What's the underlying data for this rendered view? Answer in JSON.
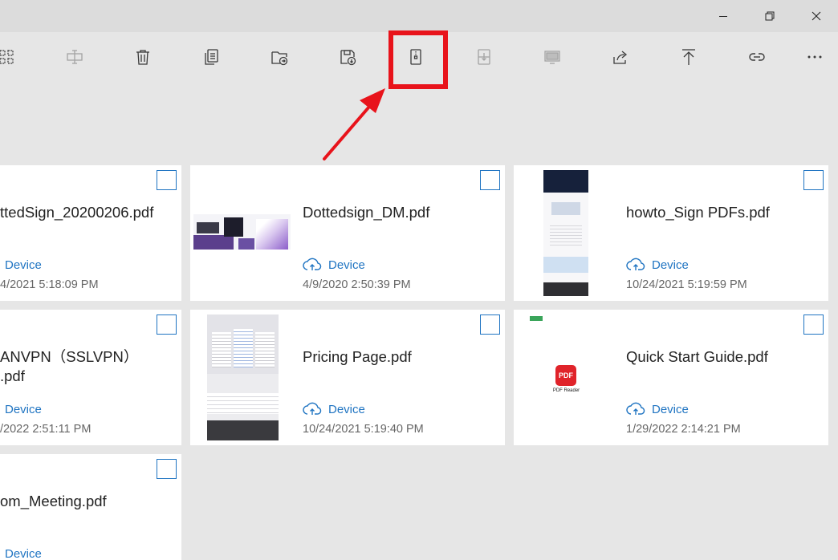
{
  "window": {
    "minimize_icon": "minimize-icon",
    "maximize_icon": "restore-icon",
    "close_icon": "close-icon"
  },
  "toolbar": {
    "buttons": [
      {
        "id": "select",
        "icon": "grid-select-icon",
        "disabled": false
      },
      {
        "id": "rename",
        "icon": "rename-icon",
        "disabled": true
      },
      {
        "id": "delete",
        "icon": "trash-icon",
        "disabled": false
      },
      {
        "id": "copy",
        "icon": "copy-icon",
        "disabled": false
      },
      {
        "id": "move",
        "icon": "move-to-folder-icon",
        "disabled": false
      },
      {
        "id": "save",
        "icon": "save-icon",
        "disabled": false
      },
      {
        "id": "compress",
        "icon": "zip-file-icon",
        "disabled": false,
        "highlighted": true
      },
      {
        "id": "extract",
        "icon": "extract-icon",
        "disabled": true
      },
      {
        "id": "present",
        "icon": "monitor-icon",
        "disabled": true
      },
      {
        "id": "share",
        "icon": "share-icon",
        "disabled": false
      },
      {
        "id": "upload",
        "icon": "upload-icon",
        "disabled": false
      },
      {
        "id": "link",
        "icon": "link-icon",
        "disabled": false
      },
      {
        "id": "more",
        "icon": "more-icon",
        "label": "···",
        "disabled": false
      }
    ]
  },
  "annotation": {
    "color": "#e8131b"
  },
  "files": [
    {
      "name": "ttedSign_20200206.pdf",
      "location": "Device",
      "date": "4/2021 5:18:09 PM"
    },
    {
      "name": "Dottedsign_DM.pdf",
      "location": "Device",
      "date": "4/9/2020 2:50:39 PM"
    },
    {
      "name": "howto_Sign PDFs.pdf",
      "location": "Device",
      "date": "10/24/2021 5:19:59 PM"
    },
    {
      "name": "ANVPN（SSLVPN）",
      "name2": ".pdf",
      "location": "Device",
      "date": "/2022 2:51:11 PM"
    },
    {
      "name": "Pricing Page.pdf",
      "location": "Device",
      "date": "10/24/2021 5:19:40 PM"
    },
    {
      "name": "Quick Start Guide.pdf",
      "location": "Device",
      "date": "1/29/2022 2:14:21 PM",
      "thumb_text": "PDF",
      "thumb_caption": "PDF Reader"
    },
    {
      "name": "om_Meeting.pdf",
      "location": "Device",
      "date": ""
    }
  ],
  "colors": {
    "accent": "#1f74c2",
    "card": "#ffffff",
    "background": "#e6e6e6"
  }
}
